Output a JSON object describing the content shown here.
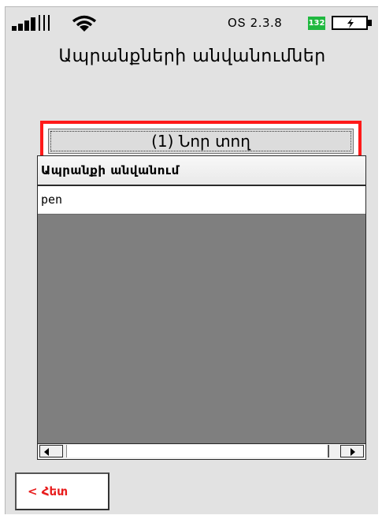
{
  "status_bar": {
    "os_version": "ՕՏ 2.3.8",
    "counter_badge": "132",
    "colors": {
      "badge": "#1fb83f"
    }
  },
  "page": {
    "title": "Ապրանքների անվանումներ"
  },
  "toolbar": {
    "new_row_label": "(1) Նոր տող",
    "highlight_color": "#ff1a1a"
  },
  "table": {
    "columns": [
      "Ապրանքի անվանում"
    ],
    "rows": [
      [
        "pen"
      ]
    ],
    "background_color": "#7f7f7f"
  },
  "footer": {
    "back_label": "< Հետ",
    "back_color": "#e81d1d"
  },
  "icons": [
    "signal-icon",
    "wifi-icon",
    "battery-charging-icon",
    "arrow-left-icon",
    "arrow-right-icon"
  ]
}
